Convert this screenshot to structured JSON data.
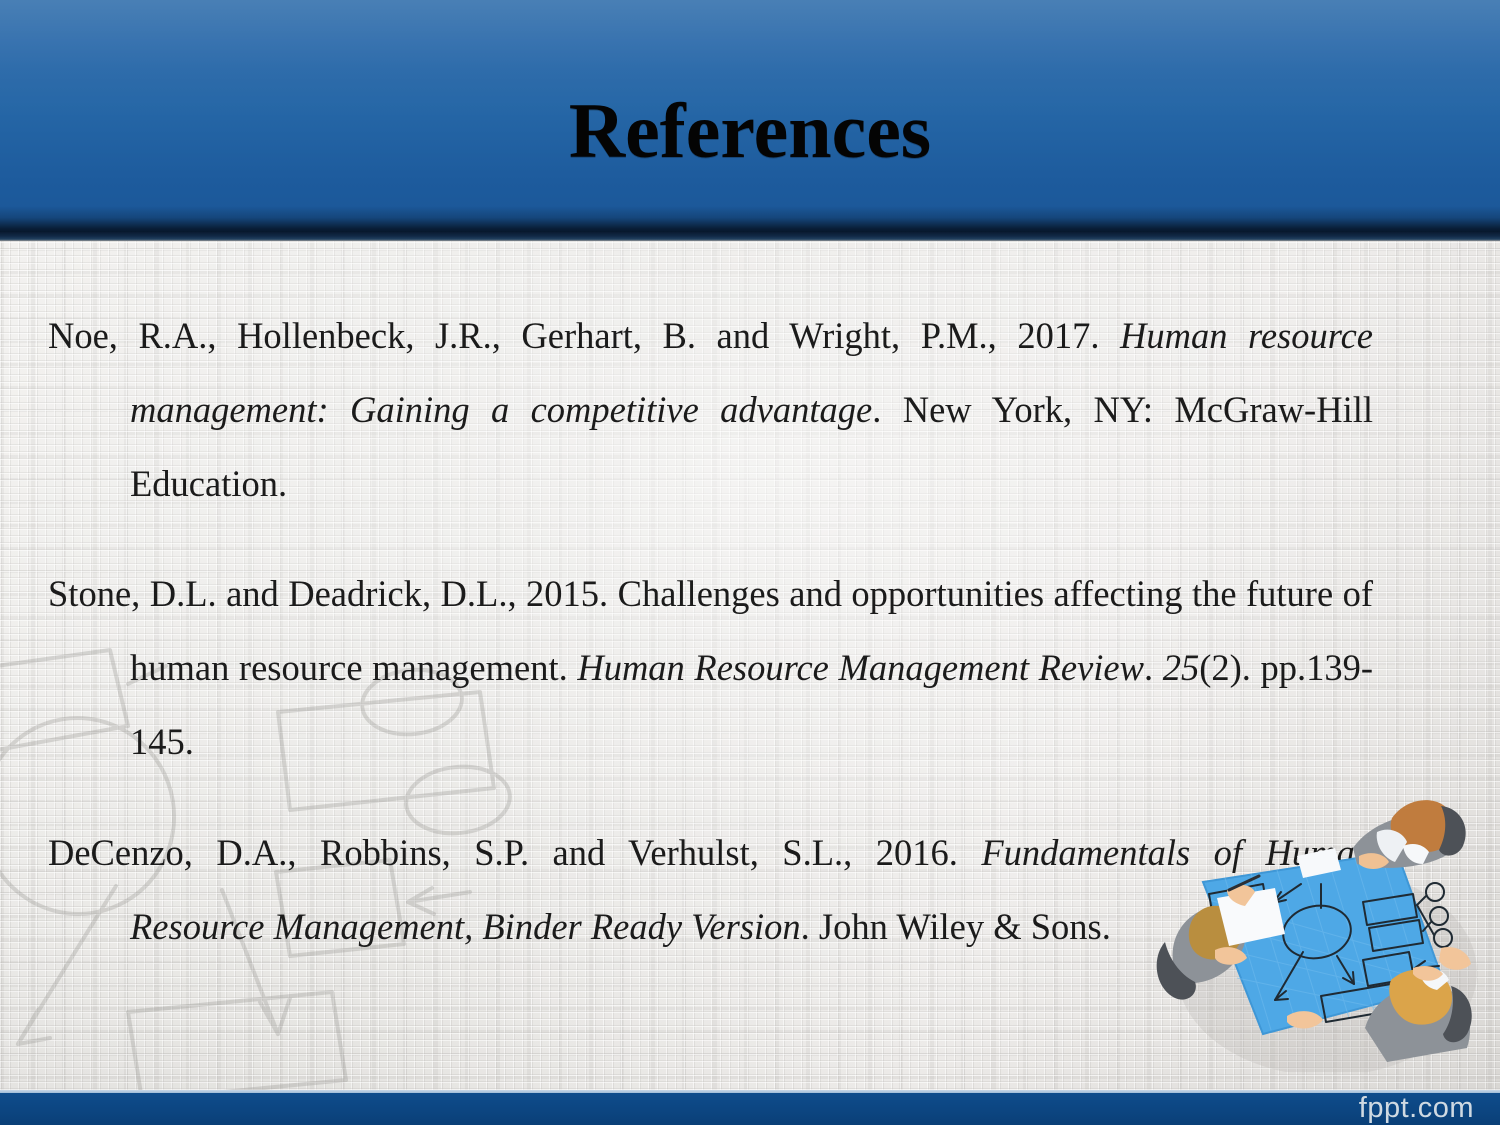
{
  "slide": {
    "title": "References",
    "footer_brand": "fppt.com"
  },
  "theme": {
    "header_top": "#3471ad",
    "header_bottom": "#1a5697",
    "header_edge": "#07182c",
    "footer_band": "#0c4682",
    "footer_text": "#cfd9e2",
    "body_background": "#e9e8e5",
    "body_text": "#1b1b1b",
    "title_text": "#040404",
    "illustration_table": "#49a6e3"
  },
  "references": [
    {
      "id": "ref-noe-2017",
      "segments": [
        {
          "text": "Noe, R.A., Hollenbeck, J.R., Gerhart, B. and Wright, P.M., 2017.  ",
          "style": "roman"
        },
        {
          "text": "Human resource management: Gaining a competitive advantage",
          "style": "italic"
        },
        {
          "text": ". New York, NY: McGraw-Hill Education.",
          "style": "roman"
        }
      ]
    },
    {
      "id": "ref-stone-2015",
      "segments": [
        {
          "text": "Stone, D.L. and Deadrick, D.L., 2015. Challenges and opportunities affecting the future of human resource management.  ",
          "style": "roman"
        },
        {
          "text": "Human Resource Management Review",
          "style": "italic"
        },
        {
          "text": ". ",
          "style": "roman"
        },
        {
          "text": "25",
          "style": "italic"
        },
        {
          "text": "(2). pp.139-145.",
          "style": "roman"
        }
      ]
    },
    {
      "id": "ref-decenzo-2016",
      "segments": [
        {
          "text": "DeCenzo, D.A., Robbins, S.P. and Verhulst, S.L., 2016.  ",
          "style": "roman"
        },
        {
          "text": "Fundamentals of Human Resource Management, Binder Ready Version",
          "style": "italic"
        },
        {
          "text": ". John Wiley & Sons.",
          "style": "roman"
        }
      ]
    }
  ],
  "illustration": {
    "name": "team-meeting-blueprint-illustration",
    "description": "Top-down view of three people seated around a blue table with a flowchart diagram"
  },
  "background_sketch": {
    "name": "faint-flowchart-watermark",
    "description": "Large faded line-art flowchart with ellipse, boxes and arrows"
  }
}
